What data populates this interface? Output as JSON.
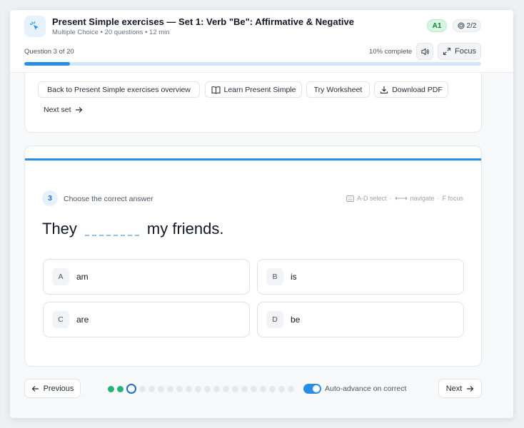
{
  "header": {
    "title": "Present Simple exercises — Set 1: Verb \"Be\": Affirmative & Negative",
    "subtitle": "Multiple Choice • 20 questions • 12 min",
    "level_badge": "A1",
    "set_count": "2/2",
    "question_progress": "Question 3 of 20",
    "percent_complete": "10% complete",
    "progress_fraction": 0.1,
    "focus_label": "Focus",
    "icons": {
      "app": "cursor-click-icon",
      "set": "layers-icon",
      "sound": "speaker-icon",
      "focus": "expand-icon"
    }
  },
  "links": {
    "overview": "Back to Present Simple exercises overview",
    "learn": "Learn Present Simple",
    "worksheet": "Try Worksheet",
    "download": "Download PDF",
    "next_set": "Next set"
  },
  "question": {
    "number": "3",
    "instruction": "Choose the correct answer",
    "shortcut_select": "A-D select",
    "shortcut_navigate": "navigate",
    "shortcut_focus": "F focus",
    "sentence_before": "They",
    "sentence_after": "my friends.",
    "options": [
      {
        "letter": "A",
        "text": "am"
      },
      {
        "letter": "B",
        "text": "is"
      },
      {
        "letter": "C",
        "text": "are"
      },
      {
        "letter": "D",
        "text": "be"
      }
    ]
  },
  "footer": {
    "previous_label": "Previous",
    "next_label": "Next",
    "auto_advance_label": "Auto-advance on correct",
    "auto_advance_on": true,
    "total_questions": 20,
    "answered_questions": 2,
    "current_question": 3
  },
  "colors": {
    "accent": "#2b8ee6",
    "success": "#22b573",
    "level_badge_bg": "#d7f5e1"
  }
}
